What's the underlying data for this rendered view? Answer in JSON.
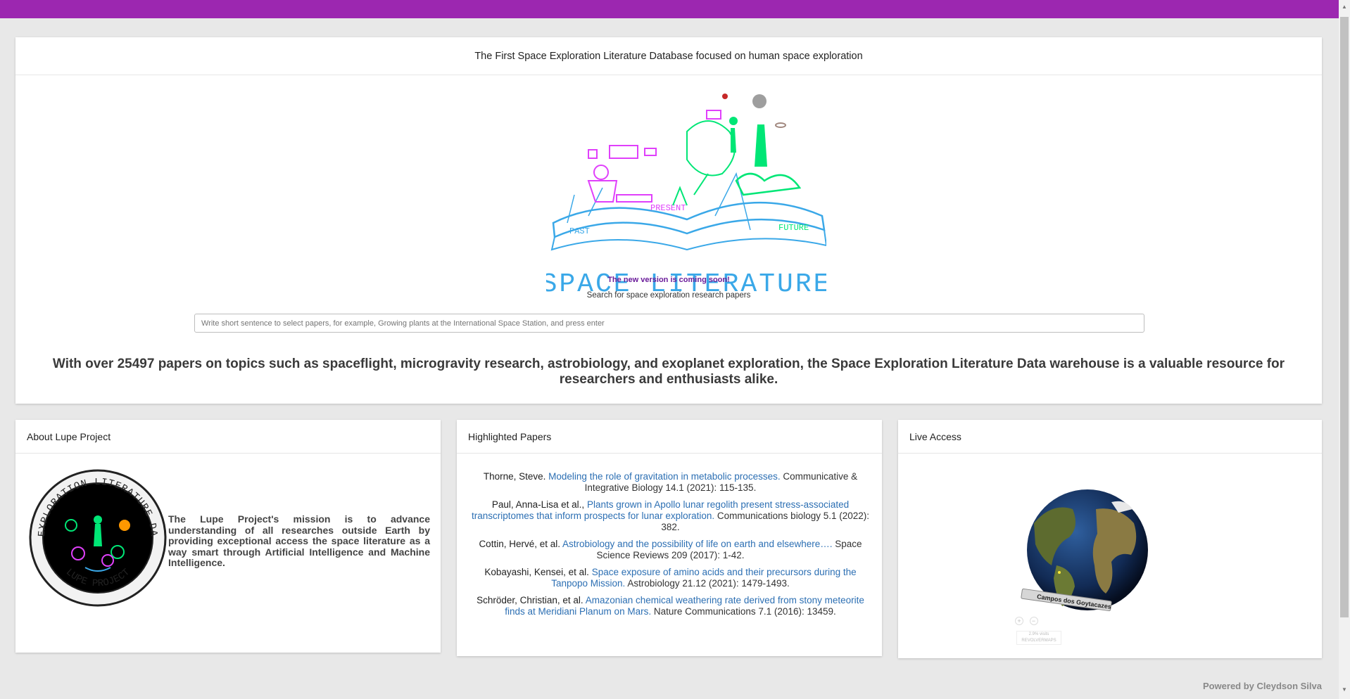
{
  "hero": {
    "header": "The First Space Exploration Literature Database focused on human space exploration",
    "logo_text": "SPACE LITERATURE",
    "logo_past": "PAST",
    "logo_present": "PRESENT",
    "logo_future": "FUTURE",
    "coming_soon": "The new version is coming soon!",
    "search_label": "Search for space exploration research papers",
    "search_placeholder": "Write short sentence to select papers, for example, Growing plants at the International Space Station, and press enter",
    "search_value": "",
    "summary": "With over 25497 papers on topics such as spaceflight, microgravity research, astrobiology, and exoplanet exploration, the Space Exploration Literature Data warehouse is a valuable resource for researchers and enthusiasts alike."
  },
  "about": {
    "title": "About Lupe Project",
    "ring_top": "SPACE EXPLORATION LITERATURE DATABASE",
    "ring_bottom": "LUPE PROJECT",
    "text": "The Lupe Project's mission is to advance understanding of all researches outside Earth by providing exceptional access the space literature as a way smart through Artificial Intelligence and Machine Intelligence."
  },
  "papers": {
    "title": "Highlighted Papers",
    "items": [
      {
        "author": "Thorne, Steve.",
        "title": "Modeling the role of gravitation in metabolic processes.",
        "source": "Communicative & Integrative Biology 14.1 (2021): 115-135."
      },
      {
        "author": "Paul, Anna-Lisa et al.,",
        "title": "Plants grown in Apollo lunar regolith present stress-associated transcriptomes that inform prospects for lunar exploration.",
        "source": "Communications biology 5.1 (2022): 382."
      },
      {
        "author": "Cottin, Hervé, et al.",
        "title": "Astrobiology and the possibility of life on earth and elsewhere….",
        "source": "Space Science Reviews 209 (2017): 1-42."
      },
      {
        "author": "Kobayashi, Kensei, et al.",
        "title": "Space exposure of amino acids and their precursors during the Tanpopo Mission.",
        "source": "Astrobiology 21.12 (2021): 1479-1493."
      },
      {
        "author": "Schröder, Christian, et al.",
        "title": "Amazonian chemical weathering rate derived from stony meteorite finds at Meridiani Planum on Mars.",
        "source": "Nature Communications 7.1 (2016): 13459."
      }
    ]
  },
  "live": {
    "title": "Live Access",
    "location_label": "Campos dos Goytacazes",
    "zoom_in": "+",
    "zoom_out": "−",
    "visits": "2.9% visits",
    "brand": "REVOLVERMAPS"
  },
  "footer": "Powered by Cleydson Silva",
  "colors": {
    "topbar": "#9c27b0",
    "accent_link": "#2c6fb3",
    "coming_soon": "#6a1b9a",
    "logo_blue": "#3aa8e8",
    "logo_magenta": "#e040fb",
    "logo_green": "#00e676"
  }
}
